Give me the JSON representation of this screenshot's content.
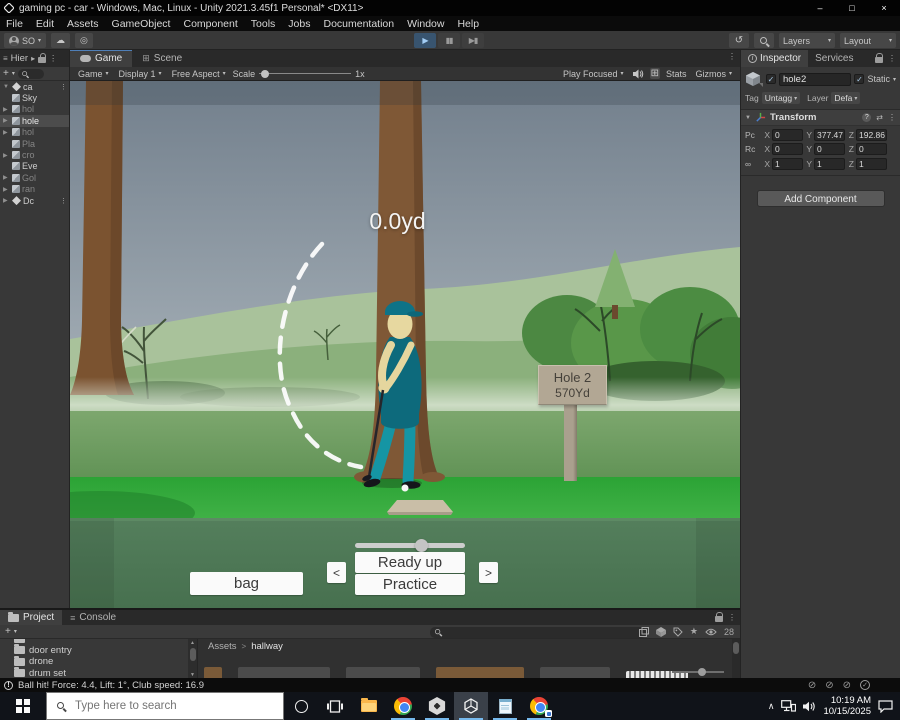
{
  "window": {
    "title": "gaming pc - car - Windows, Mac, Linux - Unity 2021.3.45f1 Personal* <DX11>",
    "menus": [
      "File",
      "Edit",
      "Assets",
      "GameObject",
      "Component",
      "Tools",
      "Jobs",
      "Documentation",
      "Window",
      "Help"
    ]
  },
  "toolbar": {
    "account": "SO",
    "layers": "Layers",
    "layout": "Layout"
  },
  "hierarchy": {
    "tab": "Hier",
    "items": [
      {
        "label": "ca"
      },
      {
        "label": "Sky"
      },
      {
        "label": "hol"
      },
      {
        "label": "hole"
      },
      {
        "label": "hol"
      },
      {
        "label": "Pla"
      },
      {
        "label": "cro"
      },
      {
        "label": "Eve"
      },
      {
        "label": "Gol"
      },
      {
        "label": "ran"
      },
      {
        "label": "Dc"
      }
    ]
  },
  "game": {
    "tab_game": "Game",
    "tab_scene": "Scene",
    "controls": {
      "target": "Game",
      "display": "Display 1",
      "aspect": "Free Aspect",
      "scale": "Scale",
      "scale_value": "1x",
      "play_focused": "Play Focused",
      "stats": "Stats",
      "gizmos": "Gizmos"
    },
    "hud_distance": "0.0yd",
    "sign": {
      "line1": "Hole 2",
      "line2": "570Yd"
    },
    "ui": {
      "bag": "bag",
      "ready": "Ready up",
      "practice": "Practice",
      "prev": "<",
      "next": ">"
    }
  },
  "inspector": {
    "tab_inspector": "Inspector",
    "tab_services": "Services",
    "object_name": "hole2",
    "static_label": "Static",
    "tag_label": "Tag",
    "tag_value": "Untagg",
    "layer_label": "Layer",
    "layer_value": "Defa",
    "axis": [
      "X",
      "Y",
      "Z"
    ],
    "transform": {
      "title": "Transform",
      "rows": [
        {
          "label": "Pc",
          "x": "0",
          "y": "377.47",
          "z": "192.86"
        },
        {
          "label": "Rc",
          "x": "0",
          "y": "0",
          "z": "0"
        },
        {
          "label": "",
          "x": "1",
          "y": "1",
          "z": "1"
        }
      ]
    },
    "add_component": "Add Component"
  },
  "project": {
    "tab_project": "Project",
    "tab_console": "Console",
    "folders": [
      "door entry",
      "drone",
      "drum set"
    ],
    "breadcrumb": {
      "root": "Assets",
      "current": "hallway"
    },
    "eye_count": "28"
  },
  "status_bar": {
    "message": "Ball hit! Force: 4.4, Lift: 1°, Club speed: 16.9"
  },
  "taskbar": {
    "search_placeholder": "Type here to search",
    "time": "10:19 AM",
    "date": "10/15/2025"
  },
  "icons": {
    "minimize": "–",
    "maximize": "□",
    "close": "×",
    "play": "▶",
    "pause": "▮▮",
    "step": "▶▮",
    "caret": "▾",
    "kebab": "⋮",
    "cloud": "☁",
    "target": "◎",
    "history": "↺",
    "hamburger": "≡",
    "foldout_open": "▼",
    "foldout_closed": "▶",
    "dock_arrow": "▸",
    "check": "✓",
    "link": "∞",
    "presets": "⇄",
    "help": "?",
    "info": "i",
    "star": "★",
    "grid": "⊞",
    "plus": "+",
    "chevron_up": "∧",
    "warning": "!",
    "crumb_sep": ">",
    "slash": "⊘",
    "scroll_up": "▲",
    "scroll_down": "▼"
  },
  "colors": {
    "accent_blue": "#4f7fb8",
    "taskbar_underline": "#76b9ed",
    "grass_bright": "#2fa839",
    "game_ui_green": "#4d7a57",
    "selection_gray": "#4c4c4c"
  }
}
